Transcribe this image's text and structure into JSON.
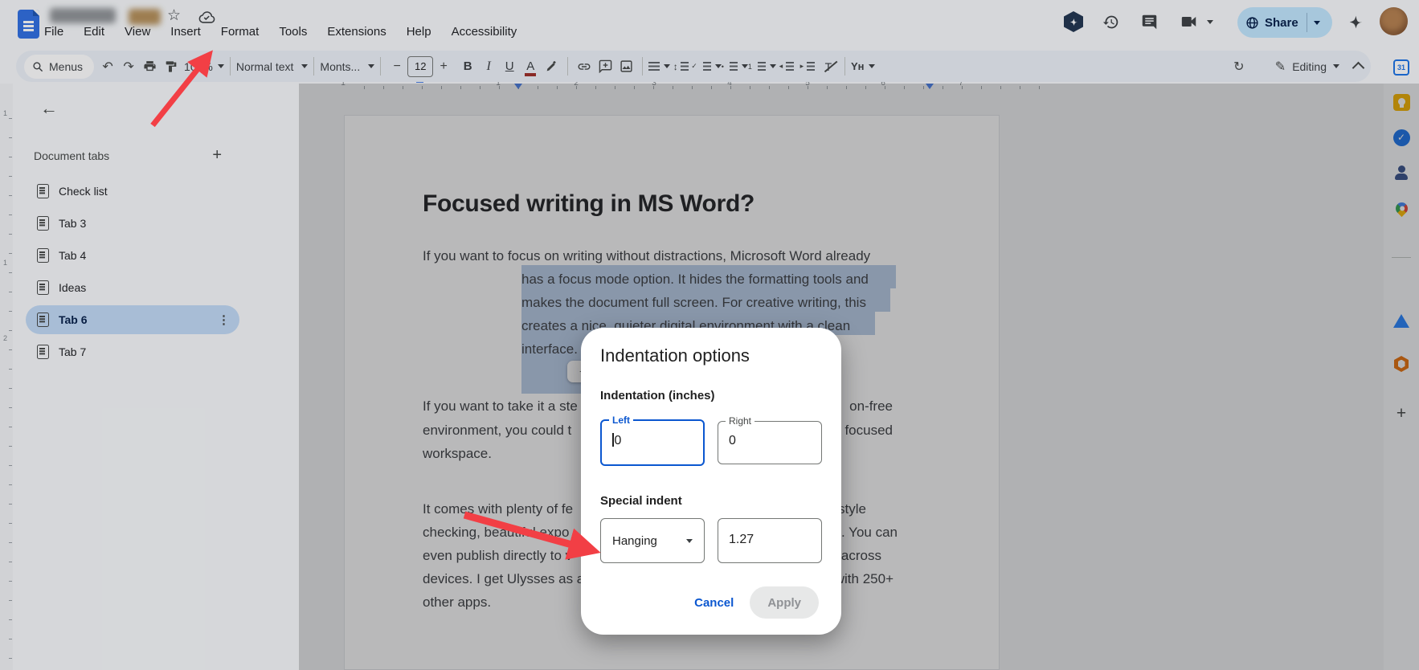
{
  "header": {
    "menus": [
      "File",
      "Edit",
      "View",
      "Insert",
      "Format",
      "Tools",
      "Extensions",
      "Help",
      "Accessibility"
    ],
    "share_label": "Share"
  },
  "toolbar": {
    "menus_button": "Menus",
    "zoom_value": "100%",
    "paragraph_style": "Normal text",
    "font_name": "Monts...",
    "font_size": "12",
    "bold": "B",
    "italic": "I",
    "underline": "U",
    "text_color": "A",
    "extension_glyph": "Yн",
    "mode_label": "Editing"
  },
  "ruler": {
    "h_numbers": [
      "1",
      "1",
      "2",
      "3",
      "4",
      "5",
      "6",
      "7"
    ],
    "v_numbers": [
      "1",
      "1",
      "2"
    ]
  },
  "sidebar": {
    "title": "Document tabs",
    "add_button": "+",
    "items": [
      {
        "label": "Check list"
      },
      {
        "label": "Tab 3"
      },
      {
        "label": "Tab 4"
      },
      {
        "label": "Ideas"
      },
      {
        "label": "Tab 6"
      },
      {
        "label": "Tab 7"
      }
    ],
    "selected": "Tab 6"
  },
  "document": {
    "heading": "Focused writing in MS Word?",
    "paragraph1": {
      "line1": "If you want to focus on writing without distractions, Microsoft Word already",
      "selected_lines": [
        "has a focus mode option. It hides the formatting tools and",
        "makes the document full screen. For creative writing, this",
        "creates a nice, quieter digital environment with a clean",
        "interface."
      ]
    },
    "paragraph2": {
      "lines": [
        {
          "left": "If you want to take it a ste",
          "right": "on-free"
        },
        {
          "left": "environment, you could t",
          "right": "focused"
        },
        {
          "left": "workspace.",
          "right": ""
        }
      ]
    },
    "paragraph3": {
      "lines": [
        {
          "left": "It comes with plenty of fe",
          "right": "style"
        },
        {
          "left": "checking, beautiful expo",
          "right": ". You can"
        },
        {
          "left": "even publish directly to v",
          "right": "across"
        },
        {
          "left": "devices. I get Ulysses as a",
          "right": "with 250+"
        },
        {
          "left": "other apps.",
          "right": ""
        }
      ]
    }
  },
  "dialog": {
    "title": "Indentation options",
    "section_indentation": "Indentation (inches)",
    "left_label": "Left",
    "left_value": "0",
    "right_label": "Right",
    "right_value": "0",
    "section_special": "Special indent",
    "special_type": "Hanging",
    "special_value": "1.27",
    "cancel_label": "Cancel",
    "apply_label": "Apply"
  },
  "rail": {
    "calendar_label": "31",
    "plus": "+"
  },
  "colors": {
    "accent_blue": "#0b57d0",
    "docs_blue": "#2f6fe4",
    "share_bg": "#c2e7ff",
    "selection": "#b9cde8",
    "selected_tab_bg": "#c3dcf8",
    "arrow_red": "#f23f45",
    "calendar_blue": "#1a73e8",
    "keep_yellow": "#f5b400",
    "tasks_blue": "#1a73e8",
    "atlassian_blue": "#2684ff",
    "addon_orange": "#e8710a"
  }
}
